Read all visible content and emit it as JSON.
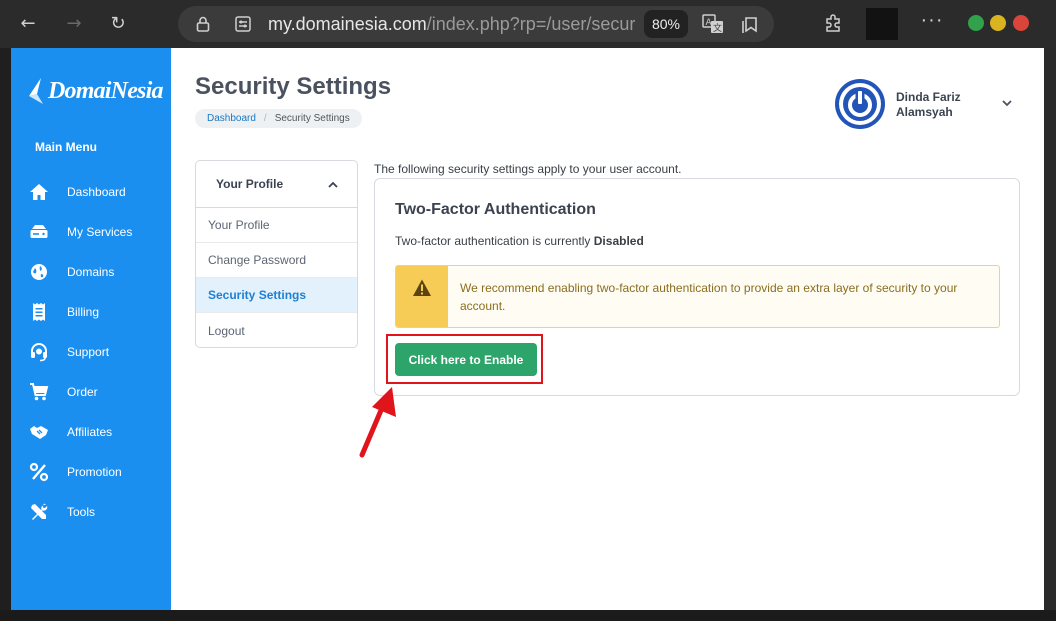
{
  "browser": {
    "url_domain": "my.domainesia.com",
    "url_path": "/index.php?rp=/user/securit",
    "zoom": "80%"
  },
  "sidebar": {
    "logo": "DomaiNesia",
    "heading": "Main Menu",
    "items": [
      {
        "label": "Dashboard",
        "icon": "home-icon"
      },
      {
        "label": "My Services",
        "icon": "server-icon"
      },
      {
        "label": "Domains",
        "icon": "globe-icon"
      },
      {
        "label": "Billing",
        "icon": "receipt-icon"
      },
      {
        "label": "Support",
        "icon": "headset-icon"
      },
      {
        "label": "Order",
        "icon": "cart-icon"
      },
      {
        "label": "Affiliates",
        "icon": "handshake-icon"
      },
      {
        "label": "Promotion",
        "icon": "percent-icon"
      },
      {
        "label": "Tools",
        "icon": "tools-icon"
      }
    ]
  },
  "header": {
    "title": "Security Settings",
    "breadcrumb": {
      "home": "Dashboard",
      "current": "Security Settings"
    },
    "user_name": "Dinda Fariz Alamsyah"
  },
  "profile_panel": {
    "title": "Your Profile",
    "items": [
      "Your Profile",
      "Change Password",
      "Security Settings",
      "Logout"
    ],
    "active_index": 2
  },
  "content": {
    "intro": "The following security settings apply to your user account.",
    "card_title": "Two-Factor Authentication",
    "status_prefix": "Two-factor authentication is currently",
    "status_value": "Disabled",
    "alert_text": "We recommend enabling two-factor authentication to provide an extra layer of security to your account.",
    "enable_button": "Click here to Enable"
  },
  "colors": {
    "sidebar": "#1b8ff0",
    "primary_button": "#2da56a",
    "alert_icon_bg": "#f7cc56",
    "highlight": "#e0141b"
  }
}
